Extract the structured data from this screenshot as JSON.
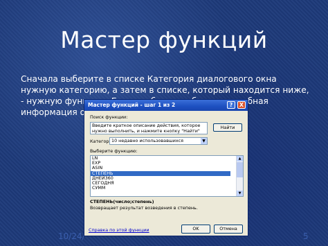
{
  "slide": {
    "title": "Мастер функций",
    "body": "Сначала выберите в списке Категория диалогового окна нужную категорию, а затем в списке, который находится ниже, - нужную функцию. Если необходима более подробная информация о ней, щелкните на",
    "date": "10/24/",
    "page": "5"
  },
  "dialog": {
    "title": "Мастер функций - шаг 1 из 2",
    "help_btn": "?",
    "close_btn": "X",
    "search_label": "Поиск функции:",
    "search_text": "Введите краткое описание действия, которое нужно выполнить, и нажмите кнопку \"Найти\"",
    "find_button": "Найти",
    "category_label": "Категория:",
    "category_value": "10 недавно использовавшихся",
    "choose_label": "Выберите функцию:",
    "functions": [
      "LN",
      "EXP",
      "ASIN",
      "СТЕПЕНЬ",
      "ДНЕЙ360",
      "СЕГОДНЯ",
      "СУММ"
    ],
    "selected_function": "СТЕПЕНЬ",
    "signature": "СТЕПЕНЬ(число;степень)",
    "description": "Возвращает результат возведения в степень.",
    "help_link": "Справка по этой функции",
    "ok_button": "OK",
    "cancel_button": "Отмена"
  }
}
